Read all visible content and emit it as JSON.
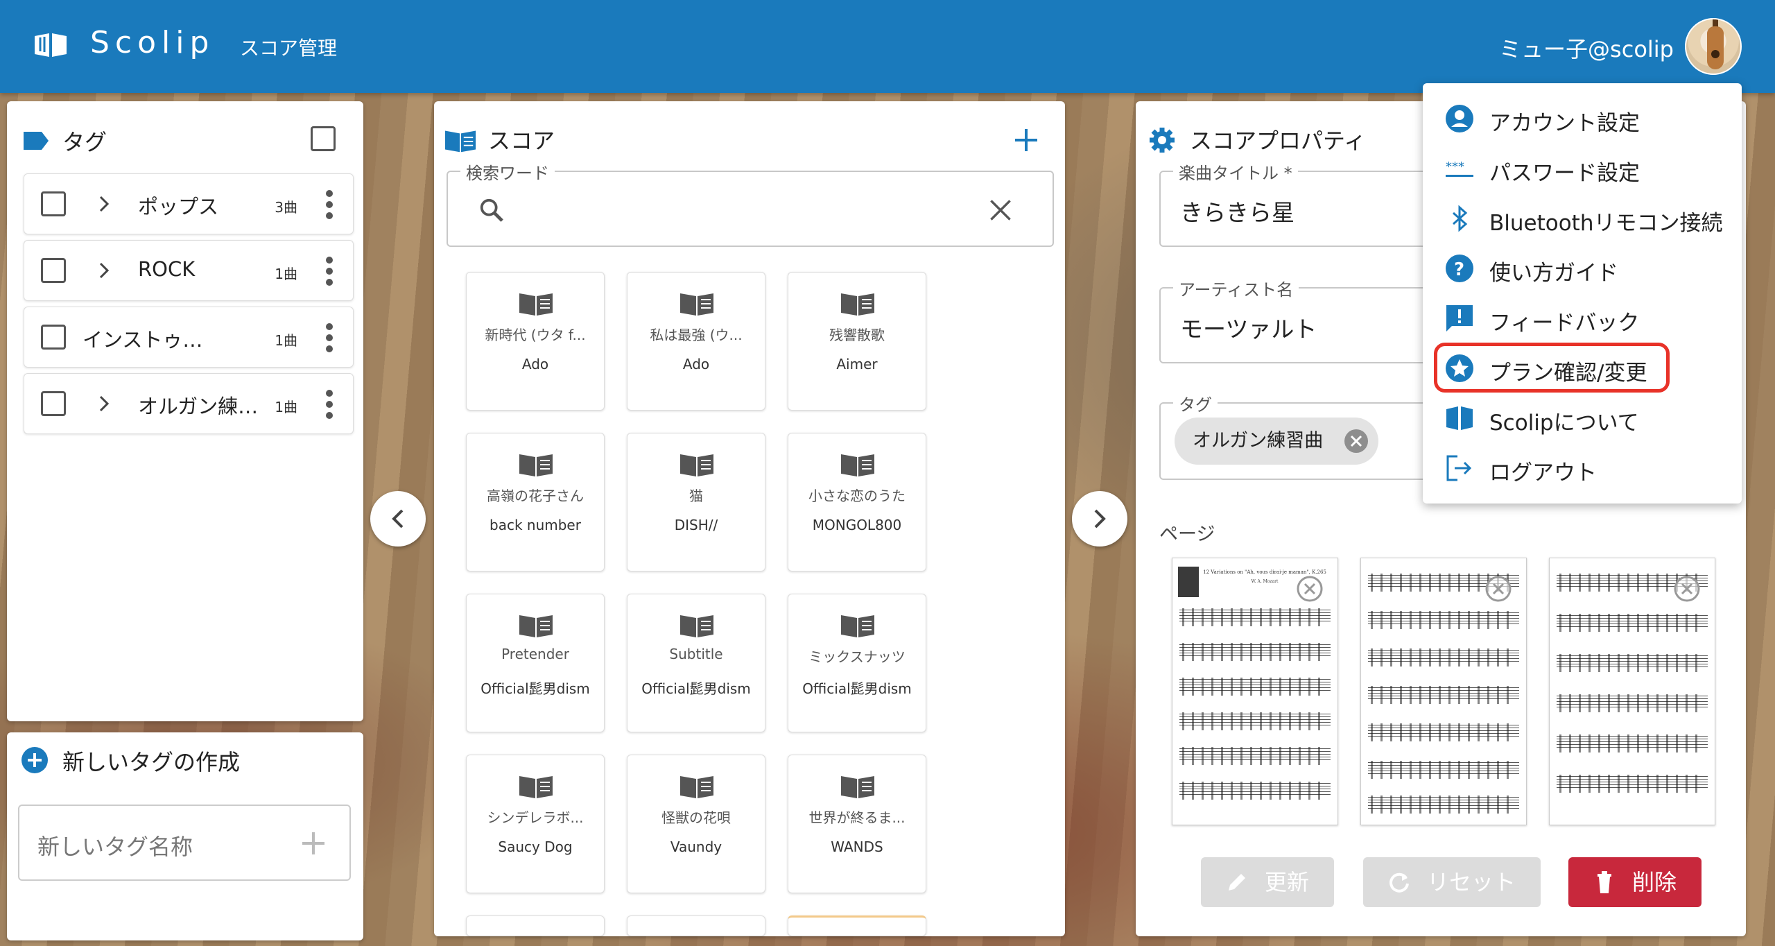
{
  "app": {
    "brand": "Scolip",
    "subtitle": "スコア管理",
    "user": "ミュー子@scolip"
  },
  "tags_panel": {
    "title": "タグ",
    "rows": [
      {
        "label": "ポップス",
        "count": "3曲",
        "expandable": true
      },
      {
        "label": "ROCK",
        "count": "1曲",
        "expandable": true
      },
      {
        "label": "インストゥ…",
        "count": "1曲",
        "expandable": false
      },
      {
        "label": "オルガン練…",
        "count": "1曲",
        "expandable": true
      }
    ]
  },
  "new_tag": {
    "title": "新しいタグの作成",
    "placeholder": "新しいタグ名称"
  },
  "scores_panel": {
    "title": "スコア",
    "search_legend": "検索ワード",
    "cards": [
      {
        "title": "新時代 (ウタ f...",
        "artist": "Ado"
      },
      {
        "title": "私は最強 (ウ...",
        "artist": "Ado"
      },
      {
        "title": "残響散歌",
        "artist": "Aimer"
      },
      {
        "title": "高嶺の花子さん",
        "artist": "back number"
      },
      {
        "title": "猫",
        "artist": "DISH//"
      },
      {
        "title": "小さな恋のうた",
        "artist": "MONGOL800"
      },
      {
        "title": "Pretender",
        "artist": "Official髭男dism"
      },
      {
        "title": "Subtitle",
        "artist": "Official髭男dism"
      },
      {
        "title": "ミックスナッツ",
        "artist": "Official髭男dism"
      },
      {
        "title": "シンデレラボ...",
        "artist": "Saucy Dog"
      },
      {
        "title": "怪獣の花唄",
        "artist": "Vaundy"
      },
      {
        "title": "世界が終るま...",
        "artist": "WANDS"
      }
    ]
  },
  "props_panel": {
    "title": "スコアプロパティ",
    "song_title_legend": "楽曲タイトル *",
    "song_title": "きらきら星",
    "artist_legend": "アーティスト名",
    "artist": "モーツァルト",
    "tag_legend": "タグ",
    "tag_chip": "オルガン練習曲",
    "pages_label": "ページ",
    "page_heading": "12 Variations on \"Ah, vous dirai-je maman\", K.265",
    "page_composer": "W. A. Mozart",
    "update_label": "更新",
    "reset_label": "リセット",
    "delete_label": "削除"
  },
  "user_menu": {
    "items": [
      {
        "label": "アカウント設定",
        "icon": "account-circle-icon"
      },
      {
        "label": "パスワード設定",
        "icon": "password-icon"
      },
      {
        "label": "Bluetoothリモコン接続",
        "icon": "bluetooth-icon"
      },
      {
        "label": "使い方ガイド",
        "icon": "help-icon"
      },
      {
        "label": "フィードバック",
        "icon": "feedback-icon"
      },
      {
        "label": "プラン確認/変更",
        "icon": "star-icon"
      },
      {
        "label": "Scolipについて",
        "icon": "book-icon"
      },
      {
        "label": "ログアウト",
        "icon": "logout-icon"
      }
    ]
  },
  "colors": {
    "primary": "#1a7abc",
    "danger": "#c8283c",
    "disabled": "#dcdcdc",
    "highlight": "#e83228"
  }
}
